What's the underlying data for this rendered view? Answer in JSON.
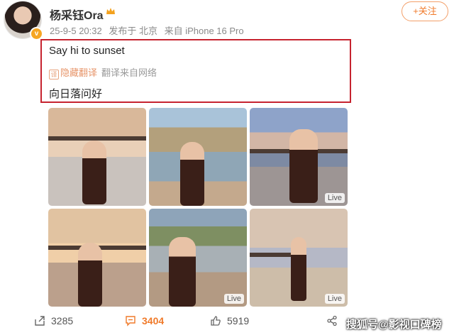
{
  "post": {
    "username": "杨采钰Ora",
    "meta": {
      "time": "25-9-5 20:32",
      "published_at": "发布于 北京",
      "source": "来自 iPhone 16 Pro"
    },
    "follow_label": "+关注",
    "text": "Say hi to sunset",
    "hide_translation_label": "隐藏翻译",
    "translation_source": "翻译来自网络",
    "translated_text": "向日落问好"
  },
  "photos": [
    {
      "live": false
    },
    {
      "live": false
    },
    {
      "live": true,
      "live_label": "Live"
    },
    {
      "live": false
    },
    {
      "live": true,
      "live_label": "Live"
    },
    {
      "live": true,
      "live_label": "Live"
    }
  ],
  "actions": {
    "reposts": "3285",
    "comments": "3404",
    "likes": "5919"
  },
  "watermark": "搜狐号@影视口碑榜",
  "colors": {
    "accent": "#f07a2a",
    "highlight_border": "#c6232f",
    "verified": "#f6a623"
  },
  "icons": [
    "repost-icon",
    "comment-icon",
    "like-icon",
    "share-icon",
    "crown-icon",
    "translate-icon"
  ]
}
